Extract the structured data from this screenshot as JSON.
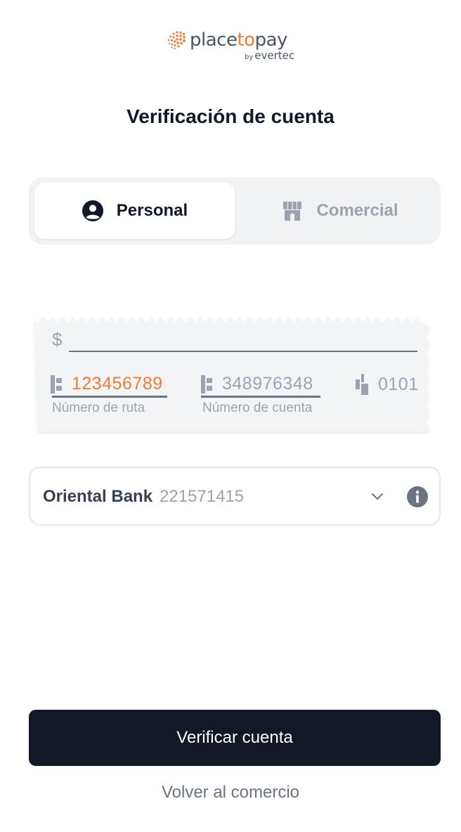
{
  "brand": {
    "name_prefix": "place",
    "name_accent": "to",
    "name_suffix": "pay",
    "sub_by": "by",
    "sub_company": "evertec",
    "accent_color": "#f07b2e"
  },
  "title": "Verificación de cuenta",
  "tabs": [
    {
      "label": "Personal",
      "icon": "user-circle-icon",
      "active": true
    },
    {
      "label": "Comercial",
      "icon": "storefront-icon",
      "active": false
    }
  ],
  "check": {
    "currency_symbol": "$",
    "routing": {
      "value": "123456789",
      "label": "Número de ruta"
    },
    "account": {
      "value": "348976348",
      "label": "Número de cuenta"
    },
    "check_number": {
      "value": "0101"
    }
  },
  "bank_select": {
    "bank_name": "Oriental Bank",
    "bank_code": "221571415",
    "dropdown_icon": "chevron-down-icon",
    "info_icon": "info-icon"
  },
  "actions": {
    "primary_label": "Verificar cuenta",
    "back_label": "Volver al comercio",
    "primary_color": "#121826"
  }
}
